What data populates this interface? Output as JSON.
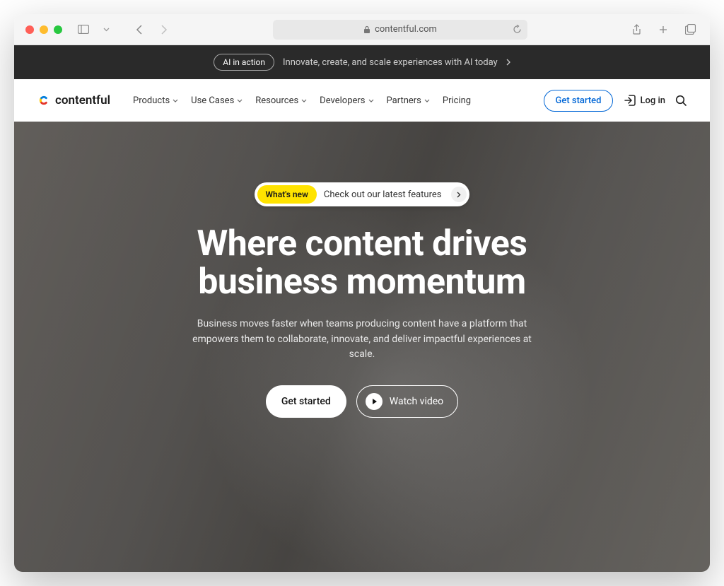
{
  "browser": {
    "address": "contentful.com"
  },
  "announce": {
    "pill": "AI in action",
    "text": "Innovate, create, and scale experiences with AI today"
  },
  "nav": {
    "logo": "contentful",
    "items": [
      "Products",
      "Use Cases",
      "Resources",
      "Developers",
      "Partners",
      "Pricing"
    ],
    "has_dropdown": [
      true,
      true,
      true,
      true,
      true,
      false
    ],
    "cta": "Get started",
    "login": "Log in"
  },
  "hero": {
    "news_badge": "What's new",
    "news_text": "Check out our latest features",
    "headline_line1": "Where content drives",
    "headline_line2": "business momentum",
    "sub": "Business moves faster when teams producing content have a platform that empowers them to collaborate, innovate, and deliver impactful experiences at scale.",
    "primary": "Get started",
    "secondary": "Watch video"
  }
}
